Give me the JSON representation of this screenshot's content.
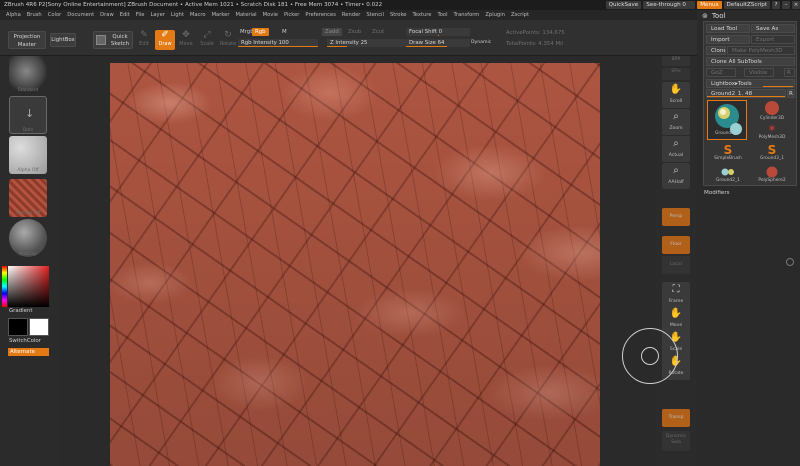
{
  "titlebar": {
    "text": "ZBrush 4R6 P2[Sony Online Entertainment]  ZBrush Document   • Active Mem 1021 • Scratch Disk 181 • Free Mem 3074 • Timer• 0.022",
    "quicksave": "QuickSave",
    "seethrough": "See-through  0",
    "seethrough_level": 0,
    "menus": "Menus",
    "defaultscript": "DefaultZScript"
  },
  "menubar": [
    "Alpha",
    "Brush",
    "Color",
    "Document",
    "Draw",
    "Edit",
    "File",
    "Layer",
    "Light",
    "Macro",
    "Marker",
    "Material",
    "Movie",
    "Picker",
    "Preferences",
    "Render",
    "Stencil",
    "Stroke",
    "Texture",
    "Tool",
    "Transform",
    "Zplugin",
    "Zscript"
  ],
  "shelf": {
    "projection_master": "Projection Master",
    "lightbox": "LightBox",
    "quick_sketch": "Quick Sketch",
    "modes": [
      {
        "label": "Edit",
        "icon": "edit-icon",
        "active": false
      },
      {
        "label": "Draw",
        "icon": "draw-icon",
        "active": true
      },
      {
        "label": "Move",
        "icon": "move-icon",
        "active": false
      },
      {
        "label": "Scale",
        "icon": "scale-icon",
        "active": false
      },
      {
        "label": "Rotate",
        "icon": "rotate-icon",
        "active": false
      }
    ],
    "mrgb": "Mrgb",
    "rgb": "Rgb",
    "m": "M",
    "zadd": "Zadd",
    "zsub": "Zsub",
    "zcut": "Zcut",
    "rgb_intensity": "Rgb Intensity 100",
    "rgb_intensity_value": 100,
    "z_intensity": "Z Intensity 25",
    "z_intensity_value": 25,
    "focal_shift": "Focal Shift 0",
    "focal_shift_value": 0,
    "draw_size": "Draw Size 64",
    "draw_size_value": 64,
    "dynamic": "Dynamic",
    "active_points": "ActivePoints: 134,675",
    "total_points": "TotalPoints: 4.354 Mil"
  },
  "lefttray": {
    "thumbs": [
      {
        "name": "brush-thumb",
        "caption": "Standard"
      },
      {
        "name": "stroke-thumb",
        "caption": "Dots"
      },
      {
        "name": "alpha-thumb",
        "caption": "Alpha Off"
      },
      {
        "name": "texture-thumb",
        "caption": "Texture Off"
      },
      {
        "name": "material-thumb",
        "caption": "MatCap"
      }
    ],
    "gradient": "Gradient",
    "switchcolor": "SwitchColor",
    "alternate": "Alternate"
  },
  "rightshelf": [
    {
      "label": "BPR",
      "icon": "bpr-icon"
    },
    {
      "label": "SPix",
      "icon": "spix-icon"
    },
    {
      "label": "Scroll",
      "icon": "scroll-icon"
    },
    {
      "label": "Zoom",
      "icon": "zoom-icon"
    },
    {
      "label": "Actual",
      "icon": "actual-icon"
    },
    {
      "label": "AAHalf",
      "icon": "aahalf-icon"
    },
    {
      "label": "Persp",
      "icon": "persp-icon"
    },
    {
      "label": "Floor",
      "icon": "floor-icon"
    },
    {
      "label": "Local",
      "icon": "local-icon"
    },
    {
      "label": "Frame",
      "icon": "frame-icon"
    },
    {
      "label": "Move",
      "icon": "move-icon"
    },
    {
      "label": "Scale",
      "icon": "scale-icon"
    },
    {
      "label": "Rotate",
      "icon": "rotate-icon"
    },
    {
      "label": "Transp",
      "icon": "transp-icon"
    },
    {
      "label": "Dynamic Solo",
      "icon": "solo-icon"
    }
  ],
  "tool": {
    "title": "Tool",
    "load_tool": "Load Tool",
    "save_as": "Save As",
    "import": "Import",
    "export": "Export",
    "clone": "Clone",
    "make_polymesh": "Make PolyMesh3D",
    "clone_all": "Clone All SubTools",
    "goz": "GoZ",
    "visible": "Visible",
    "r": "R",
    "lightbox_tools": "Lightbox▸Tools",
    "current_tool": "Ground2_1. 48",
    "current_r": "R",
    "tiles": [
      {
        "label": "Ground2_1",
        "icon": "sphere-icon"
      },
      {
        "label": "Cylinder3D",
        "icon": "cylinder-icon"
      },
      {
        "label": "PolyMesh3D",
        "icon": "star-icon"
      },
      {
        "label": "SimpleBrush",
        "icon": "simplebrush-icon"
      },
      {
        "label": "Ground3_1",
        "icon": "simplebrush-icon"
      },
      {
        "label": "Ground2_1",
        "icon": "subtool-icon"
      },
      {
        "label": "PolySphere2",
        "icon": "sphere-icon"
      }
    ],
    "modifiers": "Modifiers"
  }
}
